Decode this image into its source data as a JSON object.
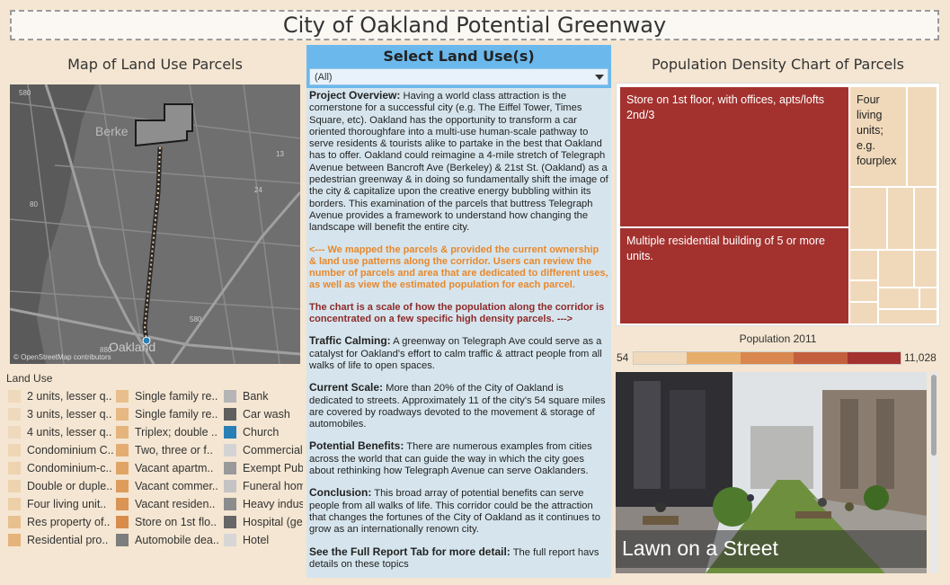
{
  "title": "City of Oakland Potential Greenway",
  "map": {
    "title": "Map of Land Use Parcels",
    "credit": "© OpenStreetMap contributors",
    "labels": {
      "city_north": "Berke",
      "city_south": "Oakland",
      "hw1": "580",
      "hw2": "80",
      "hw3": "24",
      "hw4": "13",
      "hw5": "580",
      "hw6": "880"
    }
  },
  "legend": {
    "title": "Land Use",
    "col1": [
      {
        "label": "2 units, lesser q..",
        "color": "#efd9bd"
      },
      {
        "label": "3 units, lesser q..",
        "color": "#efd9bd"
      },
      {
        "label": "4 units, lesser q..",
        "color": "#efd9bd"
      },
      {
        "label": "Condominium C..",
        "color": "#efd6b4"
      },
      {
        "label": "Condominium-c..",
        "color": "#eed3b0"
      },
      {
        "label": "Double or duple..",
        "color": "#eed3b0"
      },
      {
        "label": "Four living unit..",
        "color": "#edcfa8"
      },
      {
        "label": "Res property of..",
        "color": "#e8c08e"
      },
      {
        "label": "Residential pro..",
        "color": "#e4b47a"
      }
    ],
    "col2": [
      {
        "label": "Single family re..",
        "color": "#e8bf8c"
      },
      {
        "label": "Single family re..",
        "color": "#e6b882"
      },
      {
        "label": "Triplex; double ..",
        "color": "#e5b47c"
      },
      {
        "label": "Two, three or f..",
        "color": "#e3ad72"
      },
      {
        "label": "Vacant apartm..",
        "color": "#e0a466"
      },
      {
        "label": "Vacant commer..",
        "color": "#dd9c5b"
      },
      {
        "label": "Vacant residen..",
        "color": "#da9454"
      },
      {
        "label": "Store on 1st flo..",
        "color": "#d88c4c"
      },
      {
        "label": "Automobile dea..",
        "color": "#7d7d7d"
      }
    ],
    "col3": [
      {
        "label": "Bank",
        "color": "#b5b5b5"
      },
      {
        "label": "Car wash",
        "color": "#5f5f5f"
      },
      {
        "label": "Church",
        "color": "#2a7fb5"
      },
      {
        "label": "Commercial (",
        "color": "#d3d3d3"
      },
      {
        "label": "Exempt Publ",
        "color": "#999999"
      },
      {
        "label": "Funeral hom",
        "color": "#c4c4c4"
      },
      {
        "label": "Heavy indus",
        "color": "#8c8c8c"
      },
      {
        "label": "Hospital (ge",
        "color": "#666666"
      },
      {
        "label": "Hotel",
        "color": "#d6d6d6"
      }
    ]
  },
  "selector": {
    "title": "Select Land Use(s)",
    "value": "(All)"
  },
  "overview": {
    "p1_head": "Project Overview:",
    "p1_body": " Having a world class attraction is the cornerstone for a successful city (e.g. The Eiffel Tower, Times Square, etc). Oakland has the opportunity to transform a car oriented thoroughfare into a multi-use human-scale pathway to serve residents & tourists alike to partake in the best that Oakland has to offer. Oakland could reimagine a 4-mile stretch of Telegraph Avenue between Bancroft Ave (Berkeley) & 21st St. (Oakland) as a pedestrian greenway & in doing so fundamentally shift the image of the city & capitalize upon the creative energy bubbling within its borders. This examination of the parcels that buttress Telegraph Avenue provides a framework to understand how changing the landscape will benefit the entire city.",
    "p2": "<--- We mapped the parcels & provided the current ownership & land use patterns along the corridor. Users can review the number of parcels and area that are dedicated to different uses, as well as view the estimated population for each parcel.",
    "p3": "The chart is a scale of how the population along the corridor is concentrated on a few specific high density parcels. --->",
    "p4_head": "Traffic Calming:",
    "p4_body": " A greenway on Telegraph Ave could serve as a catalyst for Oakland's effort to calm traffic & attract people from all walks of life to open spaces.",
    "p5_head": "Current  Scale:",
    "p5_body": " More than 20% of the City of Oakland is dedicated to streets. Approximately 11 of the city's 54 square miles are covered by roadways devoted to the movement & storage of automobiles.",
    "p6_head": "Potential Benefits:",
    "p6_body": " There are numerous examples from cities across the world that can guide the way in which the city goes about rethinking how Telegraph Avenue can serve Oaklanders.",
    "p7_head": "Conclusion:",
    "p7_body": " This broad array of potential benefits can serve people from all walks of life. This corridor could be the attraction that changes the fortunes of the City of Oakland as it continues to grow as an internationally renown city.",
    "p8_head": "See the Full Report Tab for more detail:",
    "p8_body": " The full report havs details on these topics"
  },
  "density": {
    "title": "Population Density Chart of Parcels",
    "block1": "Store on 1st floor, with offices, apts/lofts 2nd/3",
    "block2": "Four living units; e.g. fourplex",
    "block3": "Multiple residential building of 5 or more units.",
    "colors": {
      "high": "#a3322f",
      "low": "#f0d9bb"
    }
  },
  "population": {
    "label": "Population 2011",
    "min": "54",
    "max": "11,028",
    "steps": [
      "#f0d9bb",
      "#e6ae6a",
      "#d9874e",
      "#c45f3e",
      "#a3322f"
    ]
  },
  "photo": {
    "caption": "Lawn on a Street"
  }
}
